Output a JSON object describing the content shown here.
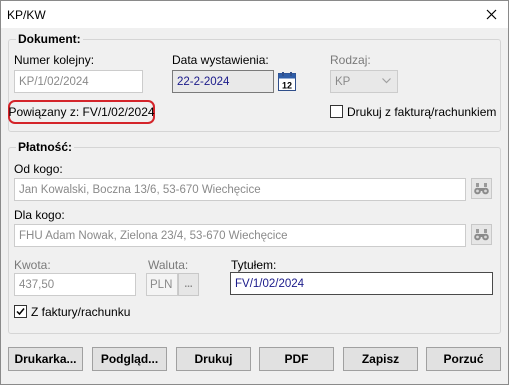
{
  "window": {
    "title": "KP/KW"
  },
  "document": {
    "legend": "Dokument:",
    "number_label": "Numer kolejny:",
    "number_value": "KP/1/02/2024",
    "date_label": "Data wystawienia:",
    "date_value": "22-2-2024",
    "calendar_day": "12",
    "type_label": "Rodzaj:",
    "type_value": "KP",
    "linked_text": "Powiązany z: FV/1/02/2024",
    "print_with_invoice_label": "Drukuj z fakturą/rachunkiem",
    "print_with_invoice_checked": false
  },
  "payment": {
    "legend": "Płatność:",
    "from_label": "Od kogo:",
    "from_value": "Jan Kowalski, Boczna 13/6, 53-670 Wiechęcice",
    "to_label": "Dla kogo:",
    "to_value": "FHU Adam Nowak, Zielona 23/4, 53-670 Wiechęcice",
    "amount_label": "Kwota:",
    "amount_value": "437,50",
    "currency_label": "Waluta:",
    "currency_value": "PLN",
    "currency_button": "...",
    "title_label": "Tytułem:",
    "title_value": "FV/1/02/2024",
    "from_invoice_label": "Z faktury/rachunku",
    "from_invoice_checked": true
  },
  "buttons": {
    "printer": "Drukarka...",
    "preview": "Podgląd...",
    "print": "Drukuj",
    "pdf": "PDF",
    "save": "Zapisz",
    "cancel": "Porzuć"
  },
  "colors": {
    "highlight_border": "#d4242a",
    "value_text": "#1a1a8a",
    "disabled_text": "#8a8a8a"
  }
}
